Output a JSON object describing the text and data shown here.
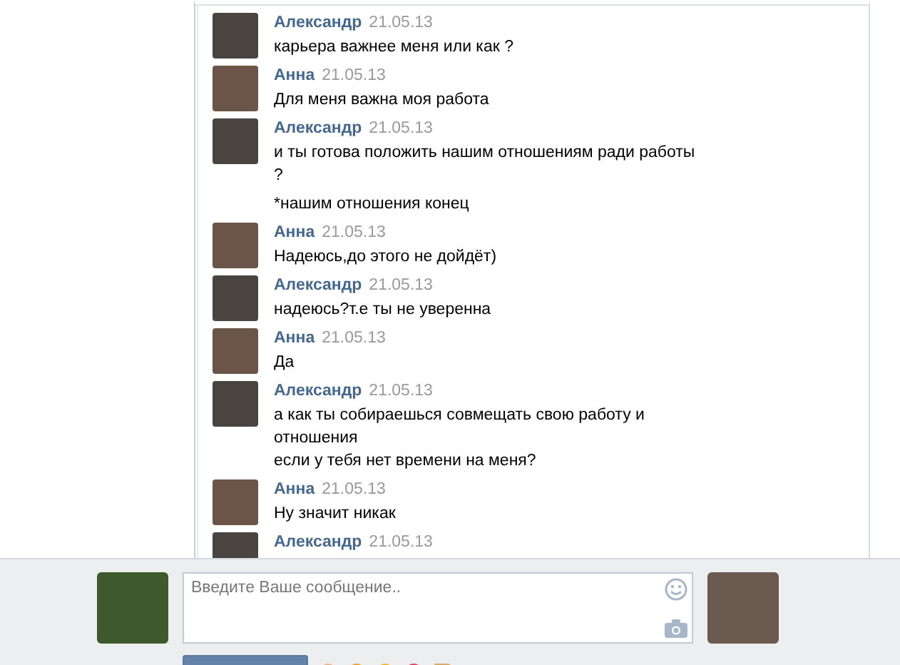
{
  "messages": [
    {
      "author": "Александр",
      "date": "21.05.13",
      "kind": "incoming",
      "paragraphs": [
        "карьера важнее меня или как ?"
      ]
    },
    {
      "author": "Анна",
      "date": "21.05.13",
      "kind": "outgoing",
      "paragraphs": [
        "Для меня важна моя работа"
      ]
    },
    {
      "author": "Александр",
      "date": "21.05.13",
      "kind": "incoming",
      "paragraphs": [
        "и ты готова положить нашим отношениям ради работы\n?",
        "*нашим отношения конец"
      ]
    },
    {
      "author": "Анна",
      "date": "21.05.13",
      "kind": "outgoing",
      "paragraphs": [
        "Надеюсь,до этого не дойдёт)"
      ]
    },
    {
      "author": "Александр",
      "date": "21.05.13",
      "kind": "incoming",
      "paragraphs": [
        "надеюсь?т.е ты не уверенна"
      ]
    },
    {
      "author": "Анна",
      "date": "21.05.13",
      "kind": "outgoing",
      "paragraphs": [
        "Да"
      ]
    },
    {
      "author": "Александр",
      "date": "21.05.13",
      "kind": "incoming",
      "paragraphs": [
        "а как ты собираешься совмещать свою работу и\nотношения\nесли у тебя нет времени на меня?"
      ]
    },
    {
      "author": "Анна",
      "date": "21.05.13",
      "kind": "outgoing",
      "paragraphs": [
        "Ну значит никак"
      ]
    },
    {
      "author": "Александр",
      "date": "21.05.13",
      "kind": "incoming"
    }
  ],
  "composer": {
    "placeholder": "Введите Ваше сообщение.."
  }
}
